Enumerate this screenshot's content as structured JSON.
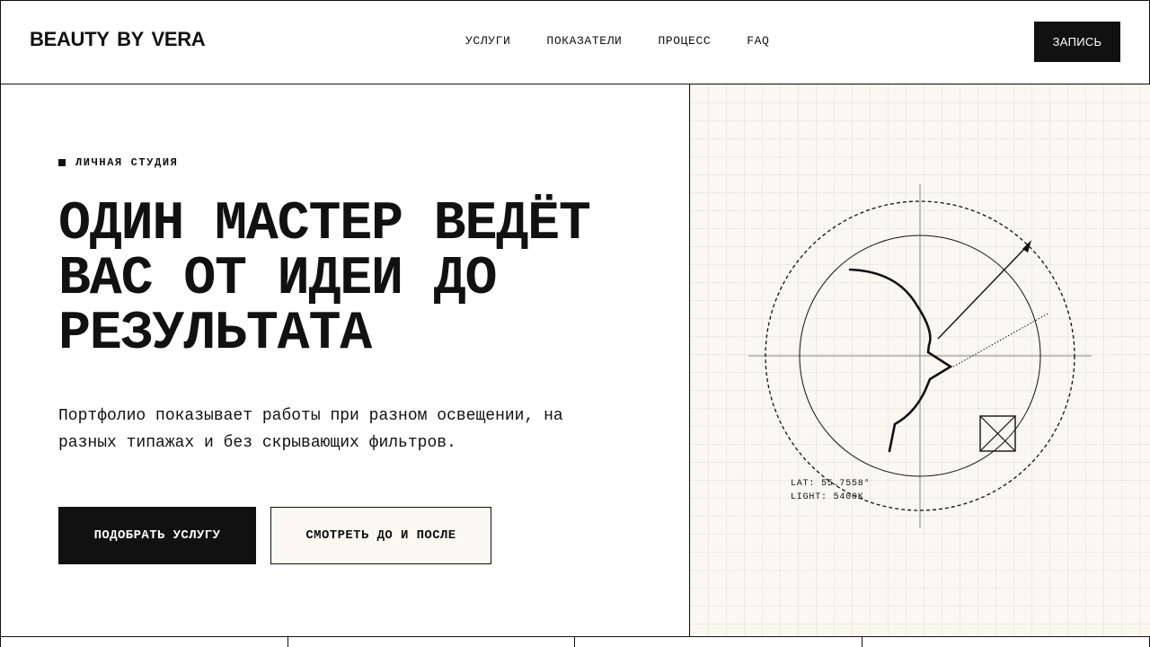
{
  "header": {
    "logo": "BEAUTY BY VERA",
    "nav": [
      {
        "label": "УСЛУГИ"
      },
      {
        "label": "ПОКАЗАТЕЛИ"
      },
      {
        "label": "ПРОЦЕСС"
      },
      {
        "label": "FAQ"
      }
    ],
    "book_label": "ЗАПИСЬ"
  },
  "hero": {
    "tag": "ЛИЧНАЯ СТУДИЯ",
    "headline_lines": [
      "ОДИН МАСТЕР ВЕДЁТ",
      "ВАС ОТ ИДЕИ ДО",
      "РЕЗУЛЬТАТА"
    ],
    "lead_lines": [
      "Портфолио показывает работы при разном освещении, на",
      "разных типажах и без скрывающих фильтров."
    ],
    "primary_button": "ПОДОБРАТЬ УСЛУГУ",
    "secondary_button": "СМОТРЕТЬ ДО И ПОСЛЕ"
  },
  "diagram": {
    "lat_readout": "LAT: 55.7558°",
    "light_readout": "LIGHT: 5400K"
  },
  "colors": {
    "ink": "#111111",
    "paper": "#ffffff",
    "panel": "#fbf8f1",
    "button_cream": "#fcf9f2"
  }
}
